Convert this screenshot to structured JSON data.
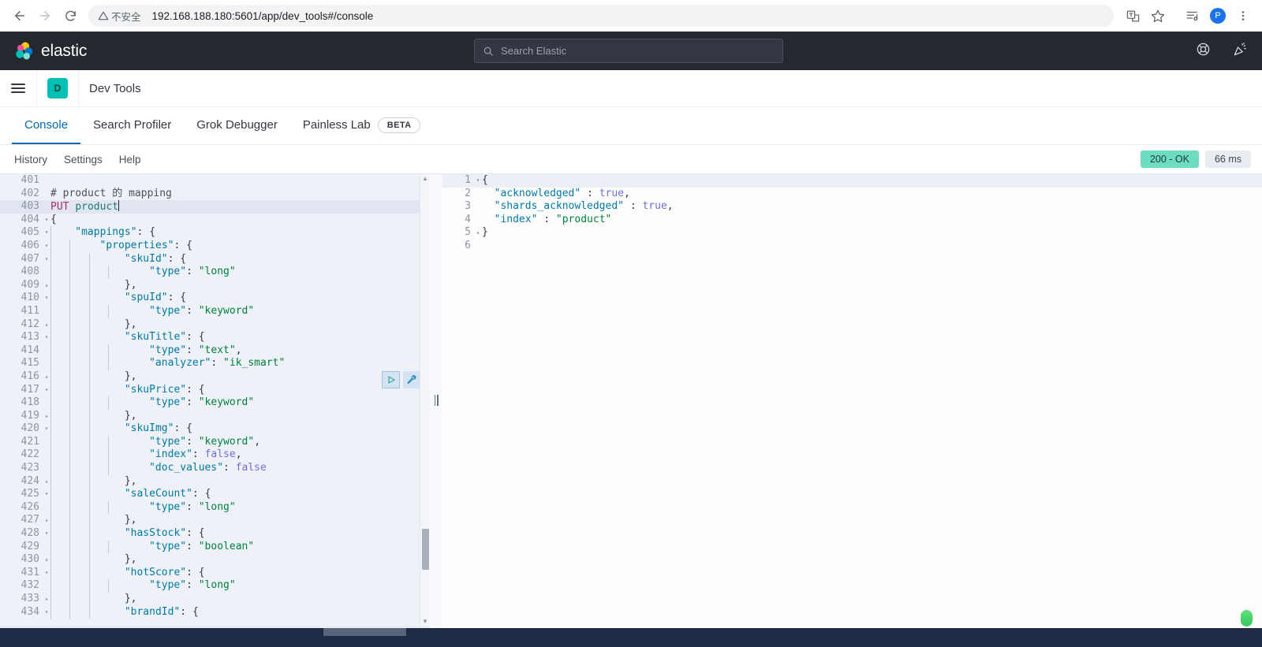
{
  "browser": {
    "back_icon": "arrow-left-icon",
    "forward_icon": "arrow-right-icon",
    "reload_icon": "reload-icon",
    "security_label": "不安全",
    "url": "192.168.188.180:5601/app/dev_tools#/console",
    "translate_icon": "translate-icon",
    "bookmark_icon": "star-icon",
    "reading_list_icon": "reading-list-icon",
    "profile_initial": "P",
    "menu_icon": "three-dot-menu-icon"
  },
  "elastic_header": {
    "brand": "elastic",
    "search_placeholder": "Search Elastic",
    "search_icon": "search-icon",
    "help_icon": "help-lifebuoy-icon",
    "news_icon": "party-popper-icon"
  },
  "app_header": {
    "menu_icon": "hamburger-menu-icon",
    "app_badge": "D",
    "title": "Dev Tools"
  },
  "tabs": [
    {
      "label": "Console",
      "active": true
    },
    {
      "label": "Search Profiler",
      "active": false
    },
    {
      "label": "Grok Debugger",
      "active": false
    },
    {
      "label": "Painless Lab",
      "active": false,
      "badge": "BETA"
    }
  ],
  "console_toolbar": {
    "links": [
      "History",
      "Settings",
      "Help"
    ],
    "status_code": "200 - OK",
    "status_color": "#6ddcc0",
    "duration": "66 ms"
  },
  "request_editor": {
    "play_icon": "play-triangle-icon",
    "wrench_icon": "wrench-icon",
    "current_line": 403,
    "first_visible_line": 401,
    "lines": [
      {
        "n": 401,
        "text": "",
        "fold": ""
      },
      {
        "n": 402,
        "text": "# product 的 mapping",
        "fold": ""
      },
      {
        "n": 403,
        "text": "PUT product",
        "fold": ""
      },
      {
        "n": 404,
        "text": "{",
        "fold": "open"
      },
      {
        "n": 405,
        "text": "    \"mappings\": {",
        "fold": "open"
      },
      {
        "n": 406,
        "text": "        \"properties\": {",
        "fold": "open"
      },
      {
        "n": 407,
        "text": "            \"skuId\": {",
        "fold": "open"
      },
      {
        "n": 408,
        "text": "                \"type\": \"long\"",
        "fold": ""
      },
      {
        "n": 409,
        "text": "            },",
        "fold": "close"
      },
      {
        "n": 410,
        "text": "            \"spuId\": {",
        "fold": "open"
      },
      {
        "n": 411,
        "text": "                \"type\": \"keyword\"",
        "fold": ""
      },
      {
        "n": 412,
        "text": "            },",
        "fold": "close"
      },
      {
        "n": 413,
        "text": "            \"skuTitle\": {",
        "fold": "open"
      },
      {
        "n": 414,
        "text": "                \"type\": \"text\",",
        "fold": ""
      },
      {
        "n": 415,
        "text": "                \"analyzer\": \"ik_smart\"",
        "fold": ""
      },
      {
        "n": 416,
        "text": "            },",
        "fold": "close"
      },
      {
        "n": 417,
        "text": "            \"skuPrice\": {",
        "fold": "open"
      },
      {
        "n": 418,
        "text": "                \"type\": \"keyword\"",
        "fold": ""
      },
      {
        "n": 419,
        "text": "            },",
        "fold": "close"
      },
      {
        "n": 420,
        "text": "            \"skuImg\": {",
        "fold": "open"
      },
      {
        "n": 421,
        "text": "                \"type\": \"keyword\",",
        "fold": ""
      },
      {
        "n": 422,
        "text": "                \"index\": false,",
        "fold": ""
      },
      {
        "n": 423,
        "text": "                \"doc_values\": false",
        "fold": ""
      },
      {
        "n": 424,
        "text": "            },",
        "fold": "close"
      },
      {
        "n": 425,
        "text": "            \"saleCount\": {",
        "fold": "open"
      },
      {
        "n": 426,
        "text": "                \"type\": \"long\"",
        "fold": ""
      },
      {
        "n": 427,
        "text": "            },",
        "fold": "close"
      },
      {
        "n": 428,
        "text": "            \"hasStock\": {",
        "fold": "open"
      },
      {
        "n": 429,
        "text": "                \"type\": \"boolean\"",
        "fold": ""
      },
      {
        "n": 430,
        "text": "            },",
        "fold": "close"
      },
      {
        "n": 431,
        "text": "            \"hotScore\": {",
        "fold": "open"
      },
      {
        "n": 432,
        "text": "                \"type\": \"long\"",
        "fold": ""
      },
      {
        "n": 433,
        "text": "            },",
        "fold": "close"
      },
      {
        "n": 434,
        "text": "            \"brandId\": {",
        "fold": "open"
      }
    ]
  },
  "response_editor": {
    "lines": [
      {
        "n": 1,
        "text": "{",
        "fold": "open"
      },
      {
        "n": 2,
        "text": "  \"acknowledged\" : true,",
        "fold": ""
      },
      {
        "n": 3,
        "text": "  \"shards_acknowledged\" : true,",
        "fold": ""
      },
      {
        "n": 4,
        "text": "  \"index\" : \"product\"",
        "fold": ""
      },
      {
        "n": 5,
        "text": "}",
        "fold": "close"
      },
      {
        "n": 6,
        "text": "",
        "fold": ""
      }
    ]
  }
}
